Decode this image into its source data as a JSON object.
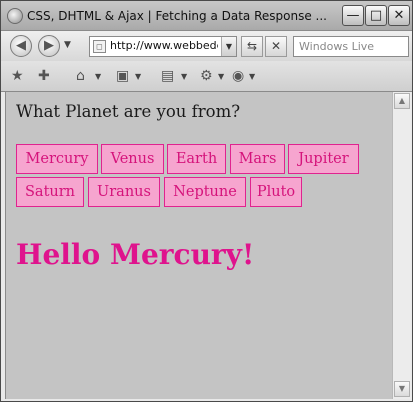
{
  "window": {
    "title": "CSS, DHTML & Ajax | Fetching a Data Response ...",
    "controls": {
      "minimize": "—",
      "maximize": "□",
      "close": "✕"
    }
  },
  "nav": {
    "back_icon": "back-arrow-icon",
    "forward_icon": "forward-arrow-icon",
    "dropdown_glyph": "▼",
    "address": "http://www.webbedе",
    "search_placeholder": "Windows Live"
  },
  "command_icons": [
    "favorites-star-icon",
    "add-favorites-icon",
    "home-icon",
    "rss-feed-icon",
    "print-icon",
    "tools-gear-icon",
    "help-icon"
  ],
  "page": {
    "question": "What Planet are you from?",
    "planets": [
      "Mercury",
      "Venus",
      "Earth",
      "Mars",
      "Jupiter",
      "Saturn",
      "Uranus",
      "Neptune",
      "Pluto"
    ],
    "greeting": "Hello Mercury!"
  },
  "colors": {
    "button_bg": "#f6a5cf",
    "button_border": "#e0238f",
    "accent_text": "#df138d",
    "content_bg": "#c4c4c4"
  }
}
